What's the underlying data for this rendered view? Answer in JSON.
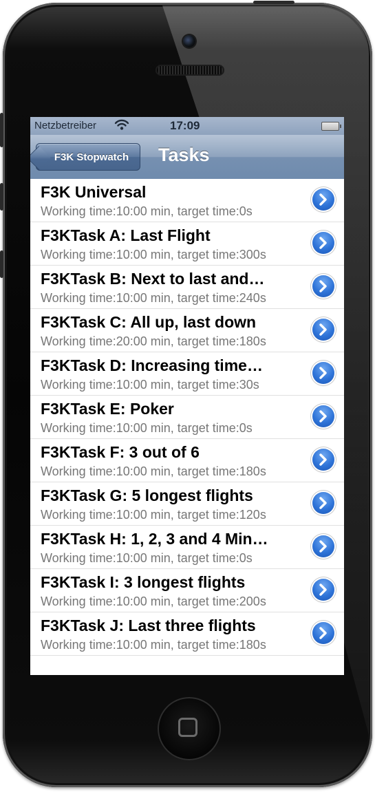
{
  "status_bar": {
    "carrier": "Netzbetreiber",
    "time": "17:09",
    "wifi_icon": "wifi-icon",
    "battery_icon": "battery-icon"
  },
  "nav_bar": {
    "back_label": "F3K Stopwatch",
    "title": "Tasks"
  },
  "tasks": [
    {
      "title": "F3K Universal",
      "subtitle": "Working time:10:00 min, target time:0s"
    },
    {
      "title": "F3KTask A: Last Flight",
      "subtitle": "Working time:10:00 min, target time:300s"
    },
    {
      "title": "F3KTask B: Next to last and…",
      "subtitle": "Working time:10:00 min, target time:240s"
    },
    {
      "title": "F3KTask C: All up, last down",
      "subtitle": "Working time:20:00 min, target time:180s"
    },
    {
      "title": "F3KTask D: Increasing time…",
      "subtitle": "Working time:10:00 min, target time:30s"
    },
    {
      "title": "F3KTask E: Poker",
      "subtitle": "Working time:10:00 min, target time:0s"
    },
    {
      "title": "F3KTask F: 3 out of 6",
      "subtitle": "Working time:10:00 min, target time:180s"
    },
    {
      "title": "F3KTask G: 5 longest flights",
      "subtitle": "Working time:10:00 min, target time:120s"
    },
    {
      "title": "F3KTask H: 1, 2, 3 and 4 Min…",
      "subtitle": "Working time:10:00 min, target time:0s"
    },
    {
      "title": "F3KTask I: 3 longest flights",
      "subtitle": "Working time:10:00 min, target time:200s"
    },
    {
      "title": "F3KTask J: Last three flights",
      "subtitle": "Working time:10:00 min, target time:180s"
    }
  ],
  "colors": {
    "nav_bar": "#7690b1",
    "disclosure": "#2f74d8"
  }
}
